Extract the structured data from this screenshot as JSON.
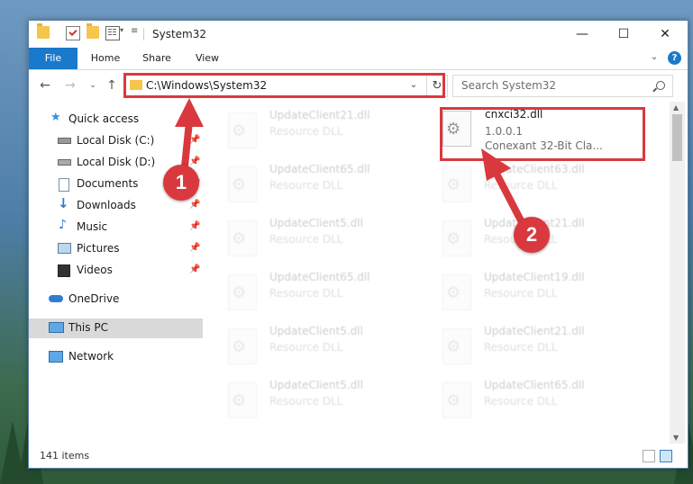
{
  "window": {
    "title": "System32"
  },
  "controls": {
    "minimize": "—",
    "maximize": "☐",
    "close": "✕"
  },
  "ribbon": {
    "tabs": [
      {
        "label": "File"
      },
      {
        "label": "Home"
      },
      {
        "label": "Share"
      },
      {
        "label": "View"
      }
    ],
    "help": "?"
  },
  "address": {
    "path": "C:\\Windows\\System32"
  },
  "search": {
    "placeholder": "Search System32"
  },
  "sidebar": {
    "items": [
      {
        "label": "Quick access"
      },
      {
        "label": "Local Disk (C:)"
      },
      {
        "label": "Local Disk (D:)"
      },
      {
        "label": "Documents"
      },
      {
        "label": "Downloads"
      },
      {
        "label": "Music"
      },
      {
        "label": "Pictures"
      },
      {
        "label": "Videos"
      },
      {
        "label": "OneDrive"
      },
      {
        "label": "This PC"
      },
      {
        "label": "Network"
      }
    ]
  },
  "files": {
    "highlighted": {
      "name": "cnxci32.dll",
      "version": "1.0.0.1",
      "description": "Conexant 32-Bit Cla..."
    },
    "left_column": [
      {
        "name": "UpdateClient21.dll",
        "type": "Resource DLL"
      },
      {
        "name": "UpdateClient65.dll",
        "type": "Resource DLL"
      },
      {
        "name": "UpdateClient5.dll",
        "type": "Resource DLL"
      },
      {
        "name": "UpdateClient65.dll",
        "type": "Resource DLL"
      },
      {
        "name": "UpdateClient5.dll",
        "type": "Resource DLL"
      },
      {
        "name": "UpdateClient5.dll",
        "type": "Resource DLL"
      }
    ],
    "right_column": [
      {
        "name": "UpdateClient63.dll",
        "type": "Resource DLL"
      },
      {
        "name": "UpdateClient21.dll",
        "type": "Resource DLL"
      },
      {
        "name": "UpdateClient19.dll",
        "type": "Resource DLL"
      },
      {
        "name": "UpdateClient21.dll",
        "type": "Resource DLL"
      },
      {
        "name": "UpdateClient65.dll",
        "type": "Resource DLL"
      }
    ]
  },
  "status": {
    "item_count": "141 items"
  },
  "callouts": {
    "one": "1",
    "two": "2"
  },
  "colors": {
    "accent": "#1979ca",
    "highlight": "#d9393e",
    "selected": "#d9d9d9"
  }
}
